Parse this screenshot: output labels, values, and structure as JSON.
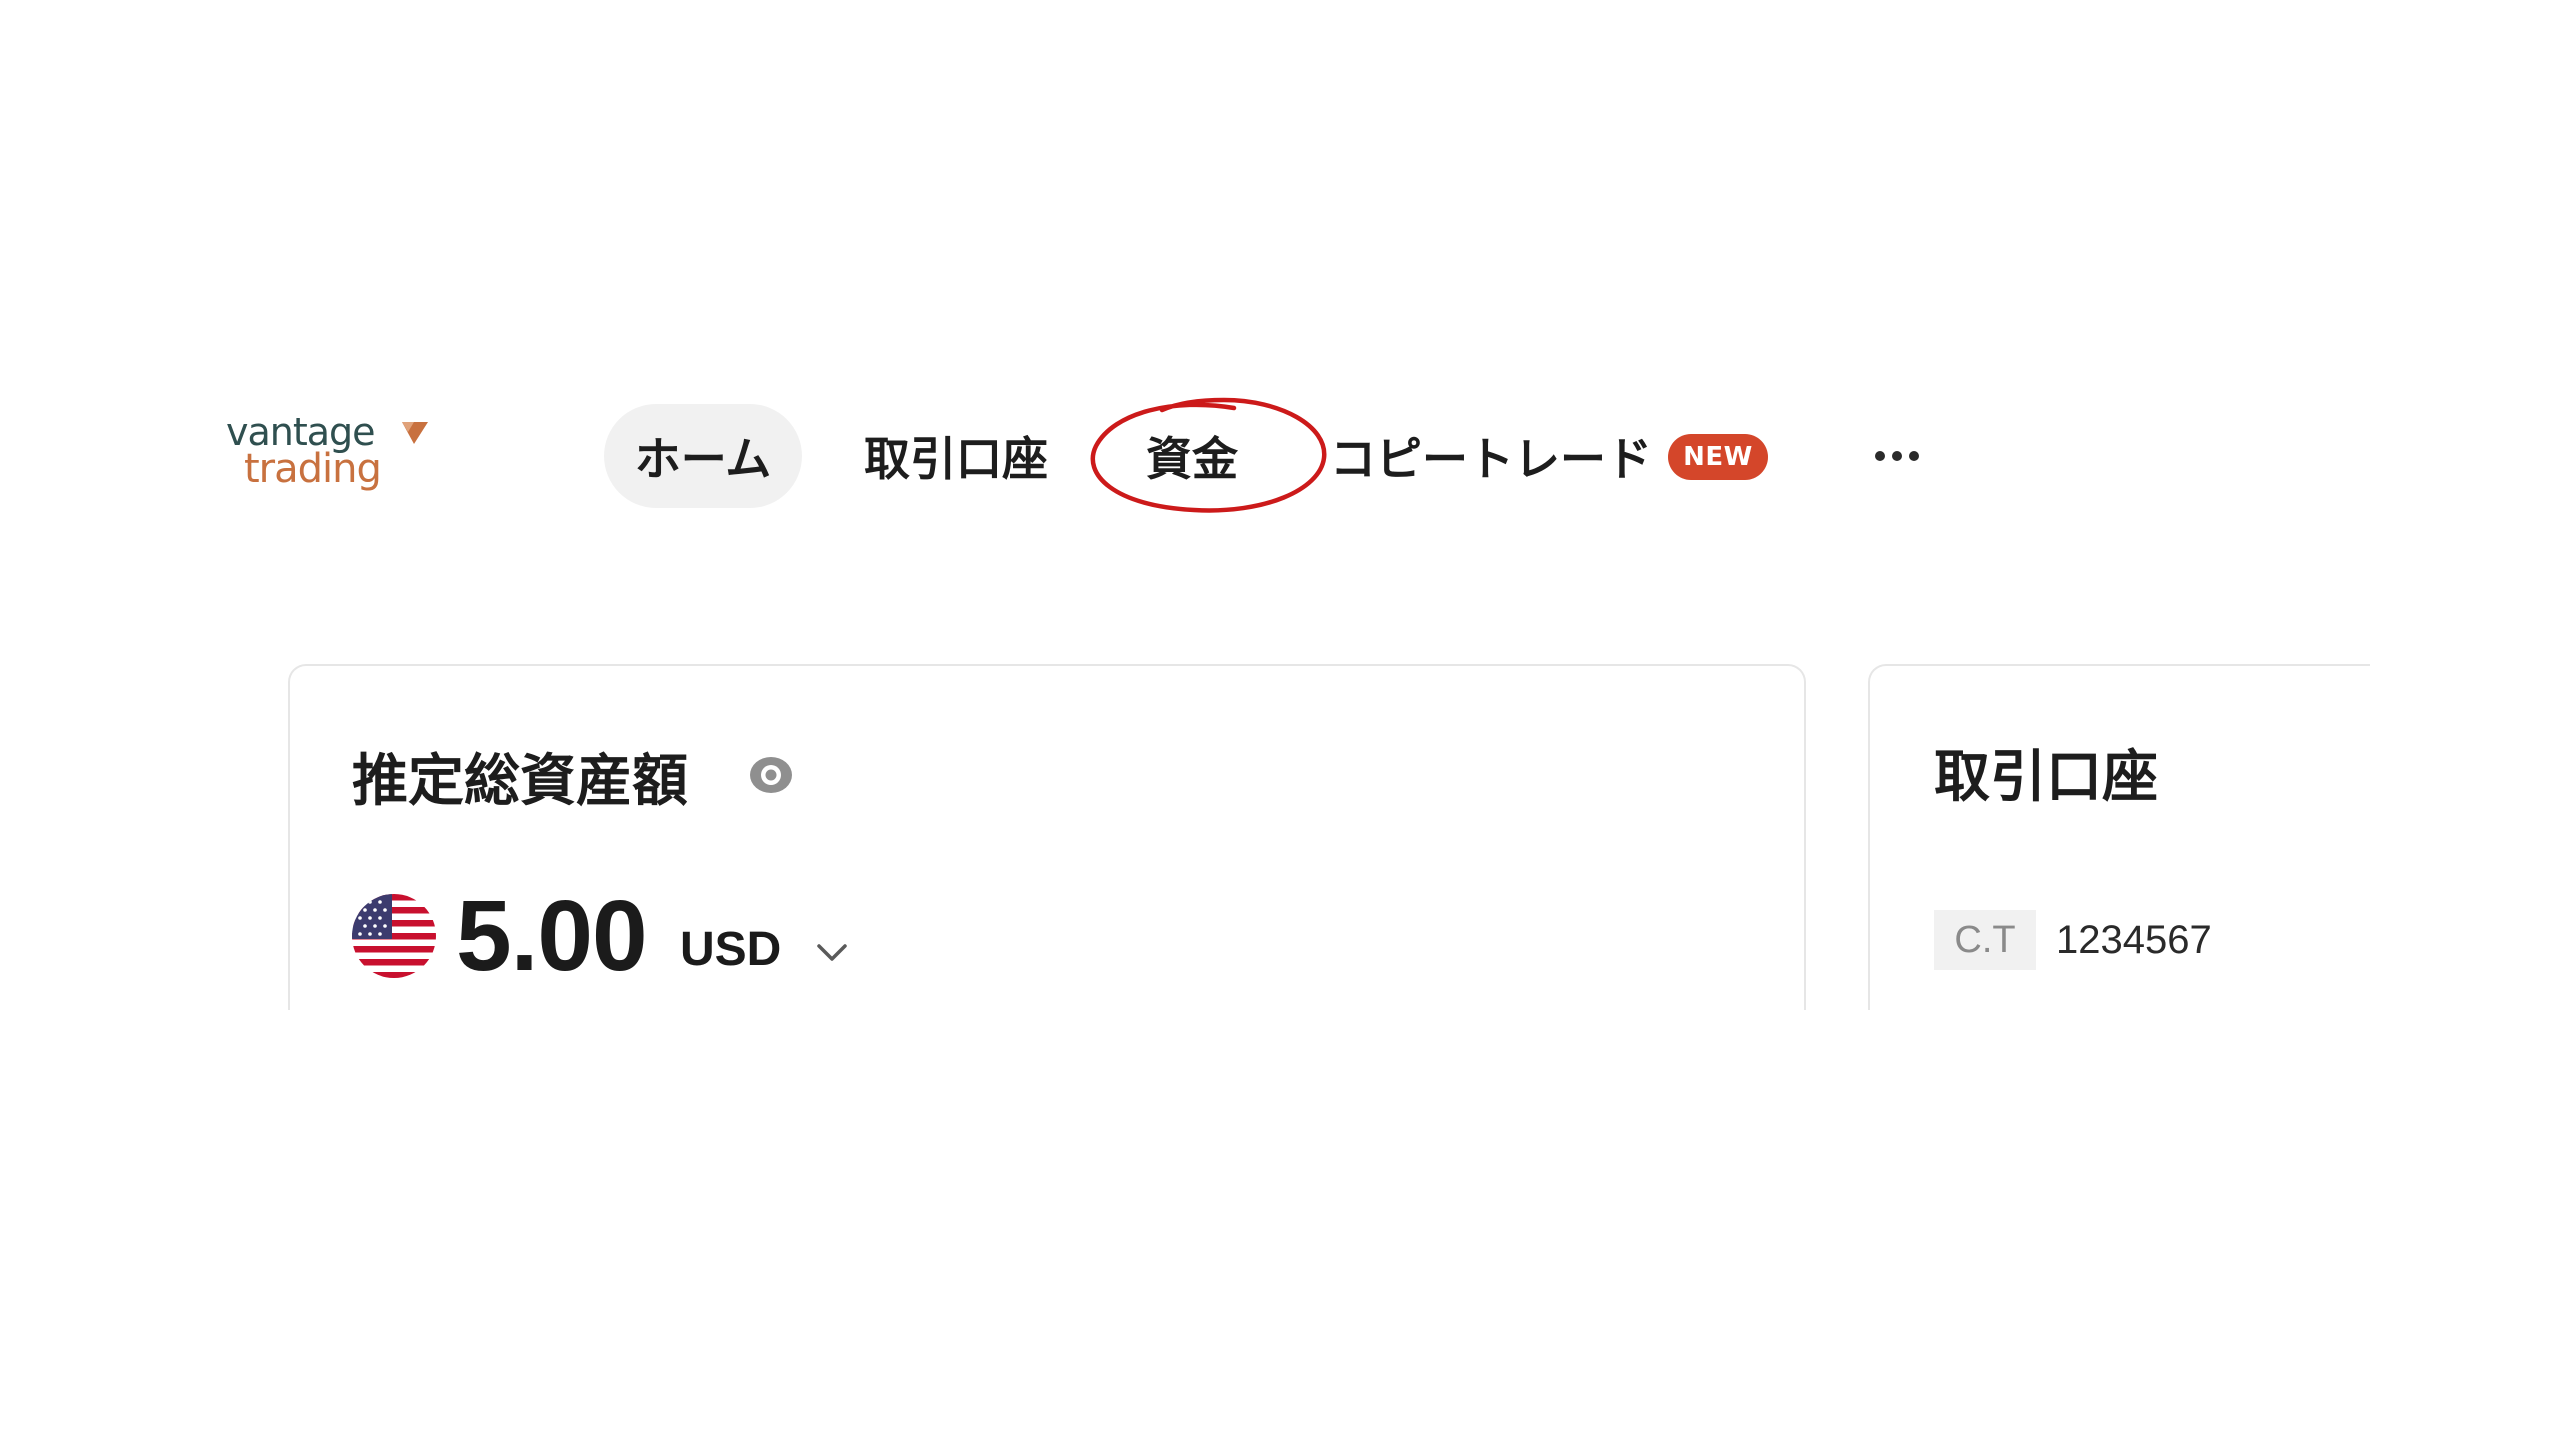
{
  "logo": {
    "line1": "vantage",
    "line2": "trading",
    "primary_color": "#2f4f4f",
    "accent_color": "#c8713f"
  },
  "nav": {
    "items": [
      {
        "label": "ホーム",
        "active": true
      },
      {
        "label": "取引口座",
        "active": false
      },
      {
        "label": "資金",
        "active": false,
        "highlighted": true
      },
      {
        "label": "コピートレード",
        "active": false,
        "badge": "NEW"
      }
    ],
    "more_icon": "more-horizontal-icon",
    "badge_color": "#d4462a",
    "annotation_color": "#cc1a1a"
  },
  "assets_card": {
    "title": "推定総資産額",
    "visibility_icon": "eye-icon",
    "flag_icon": "us-flag-icon",
    "amount": "5.00",
    "currency": "USD",
    "dropdown_icon": "chevron-down-icon"
  },
  "accounts_card": {
    "title": "取引口座",
    "account_type": "C.T",
    "account_number": "1234567"
  }
}
